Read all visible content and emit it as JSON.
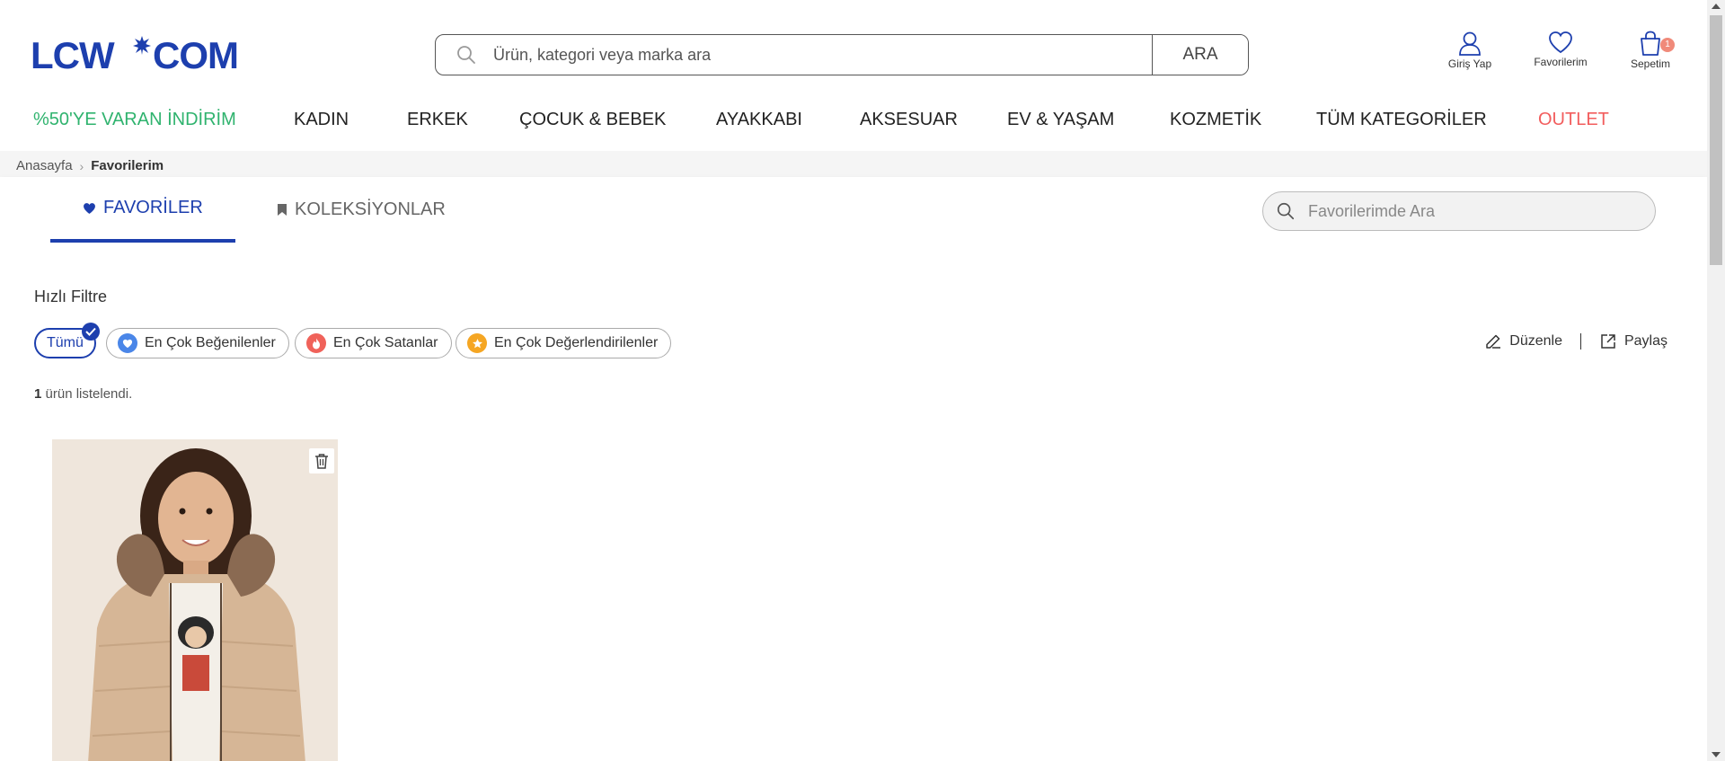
{
  "header": {
    "logo_text": "LCW·COM",
    "search": {
      "placeholder": "Ürün, kategori veya marka ara",
      "value": "",
      "button_label": "ARA"
    },
    "actions": {
      "login_label": "Giriş Yap",
      "favorites_label": "Favorilerim",
      "cart_label": "Sepetim",
      "cart_count": "1"
    }
  },
  "nav": {
    "items": [
      {
        "label": "%50'YE VARAN İNDİRİM"
      },
      {
        "label": "KADIN"
      },
      {
        "label": "ERKEK"
      },
      {
        "label": "ÇOCUK & BEBEK"
      },
      {
        "label": "AYAKKABI"
      },
      {
        "label": "AKSESUAR"
      },
      {
        "label": "EV & YAŞAM"
      },
      {
        "label": "KOZMETİK"
      },
      {
        "label": "TÜM KATEGORİLER"
      },
      {
        "label": "OUTLET"
      }
    ]
  },
  "breadcrumb": {
    "home": "Anasayfa",
    "current": "Favorilerim"
  },
  "tabs": {
    "favorites_label": "FAVORİLER",
    "collections_label": "KOLEKSİYONLAR",
    "search_placeholder": "Favorilerimde Ara",
    "search_value": ""
  },
  "quick_filter": {
    "title": "Hızlı Filtre",
    "chips": [
      {
        "label": "Tümü",
        "selected": true
      },
      {
        "label": "En Çok Beğenilenler",
        "icon": "heart-icon",
        "color": "#4a86e8"
      },
      {
        "label": "En Çok Satanlar",
        "icon": "fire-icon",
        "color": "#f0625a"
      },
      {
        "label": "En Çok Değerlendirilenler",
        "icon": "star-icon",
        "color": "#f5a623"
      }
    ],
    "edit_label": "Düzenle",
    "share_label": "Paylaş"
  },
  "listing": {
    "count": "1",
    "count_suffix": " ürün listelendi."
  },
  "colors": {
    "brand_blue": "#1d3fae",
    "promo_green": "#2fb36e",
    "outlet_red": "#f25d5d"
  }
}
